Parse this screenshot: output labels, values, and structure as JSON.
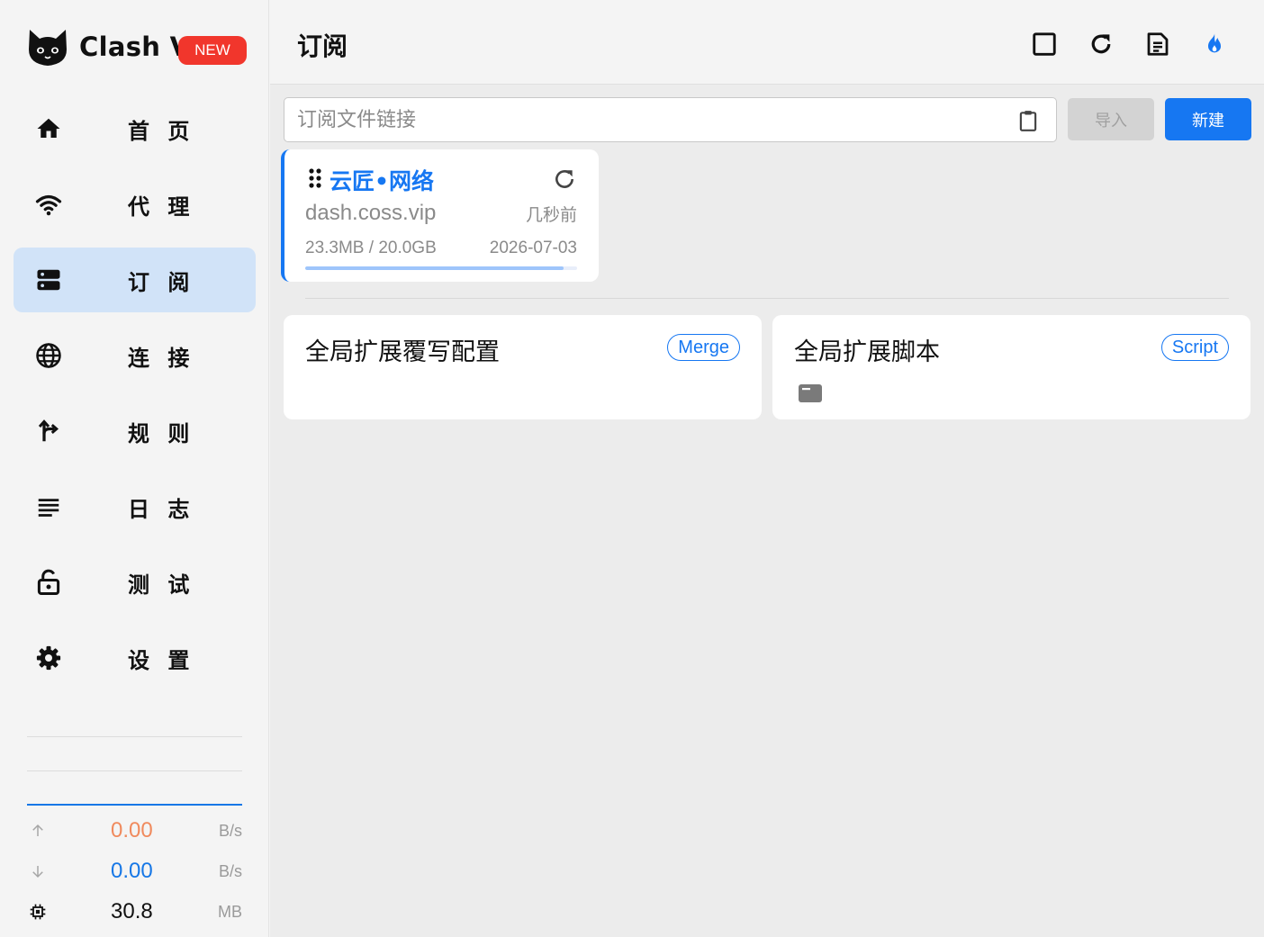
{
  "app": {
    "name": "Clash V",
    "badge": "NEW"
  },
  "sidebar": {
    "items": [
      {
        "label": "首 页",
        "icon": "home-icon",
        "active": false
      },
      {
        "label": "代 理",
        "icon": "wifi-icon",
        "active": false
      },
      {
        "label": "订 阅",
        "icon": "server-icon",
        "active": true
      },
      {
        "label": "连 接",
        "icon": "globe-icon",
        "active": false
      },
      {
        "label": "规 则",
        "icon": "fork-icon",
        "active": false
      },
      {
        "label": "日 志",
        "icon": "list-icon",
        "active": false
      },
      {
        "label": "测 试",
        "icon": "lock-open-icon",
        "active": false
      },
      {
        "label": "设 置",
        "icon": "gear-icon",
        "active": false
      }
    ],
    "traffic": {
      "upload_value": "0.00",
      "upload_unit": "B/s",
      "download_value": "0.00",
      "download_unit": "B/s",
      "memory_value": "30.8",
      "memory_unit": "MB"
    }
  },
  "header": {
    "title": "订阅"
  },
  "toolbar": {
    "url_placeholder": "订阅文件链接",
    "import_label": "导入",
    "new_label": "新建"
  },
  "profile": {
    "name": "云匠•网络",
    "host": "dash.coss.vip",
    "updated": "几秒前",
    "usage": "23.3MB / 20.0GB",
    "expire": "2026-07-03",
    "usage_fraction": 0.95
  },
  "extensions": [
    {
      "title": "全局扩展覆写配置",
      "tag": "Merge"
    },
    {
      "title": "全局扩展脚本",
      "tag": "Script"
    }
  ],
  "colors": {
    "accent": "#1677f2",
    "active_nav": "#d1e3f8",
    "upload": "#f08a5d",
    "badge": "#f1362c"
  }
}
